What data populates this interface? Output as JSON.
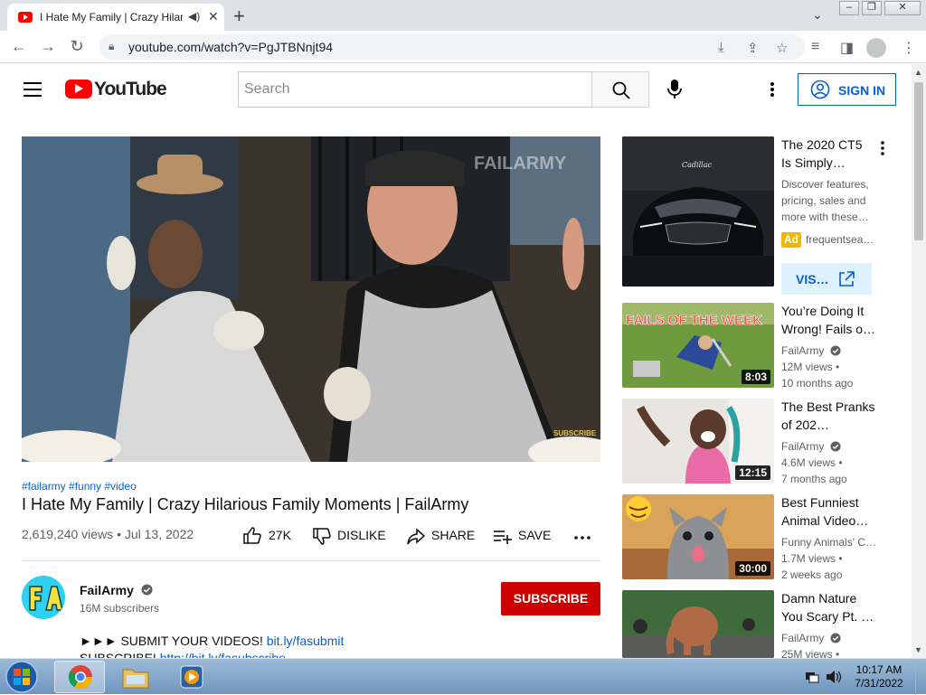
{
  "browser": {
    "tab_title": "I Hate My Family | Crazy Hilarious Family Moments | FailArmy",
    "url": "youtube.com/watch?v=PgJTBNnjt94"
  },
  "header": {
    "logo_text": "YouTube",
    "search_placeholder": "Search",
    "signin_label": "SIGN IN"
  },
  "video": {
    "watermark": "FAILARMY",
    "corner_text": "SUBSCRIBE",
    "hashtags": "#failarmy #funny #video",
    "title": "I Hate My Family | Crazy Hilarious Family Moments | FailArmy",
    "views_date": "2,619,240 views • Jul 13, 2022",
    "like_count": "27K",
    "dislike_label": "DISLIKE",
    "share_label": "SHARE",
    "save_label": "SAVE"
  },
  "channel": {
    "name": "FailArmy",
    "subscribers": "16M subscribers",
    "subscribe_label": "SUBSCRIBE",
    "desc_line1_prefix": "►►► SUBMIT YOUR VIDEOS! ",
    "desc_line1_link": "bit.ly/fasubmit",
    "desc_line2_prefix": "SUBSCRIBE! ",
    "desc_line2_link": "http://bit.ly/fasubscribe"
  },
  "ad": {
    "title": "The 2020 CT5 Is Simply…",
    "description": "Discover features, pricing, sales and more with these…",
    "badge": "Ad",
    "advertiser": "frequentsea…",
    "visit_label": "VIS…",
    "thumb_text": "Cadillac"
  },
  "related": [
    {
      "title": "You’re Doing It Wrong! Fails o…",
      "channel": "FailArmy",
      "views": "12M views •",
      "age": "10 months ago",
      "duration": "8:03",
      "thumb_text": "FAILS OF THE WEEK"
    },
    {
      "title": "The Best Pranks of 202…",
      "channel": "FailArmy",
      "views": "4.6M views •",
      "age": "7 months ago",
      "duration": "12:15"
    },
    {
      "title": "Best Funniest Animal Video…",
      "channel": "Funny Animals' C…",
      "views": "1.7M views •",
      "age": "2 weeks ago",
      "duration": "30:00"
    },
    {
      "title": "Damn Nature You Scary Pt. …",
      "channel": "FailArmy",
      "views": "25M views •",
      "age": ""
    }
  ],
  "taskbar": {
    "time": "10:17 AM",
    "date": "7/31/2022"
  },
  "colors": {
    "youtube_red": "#ff0000",
    "subscribe_red": "#cc0000",
    "link_blue": "#065fd4"
  }
}
